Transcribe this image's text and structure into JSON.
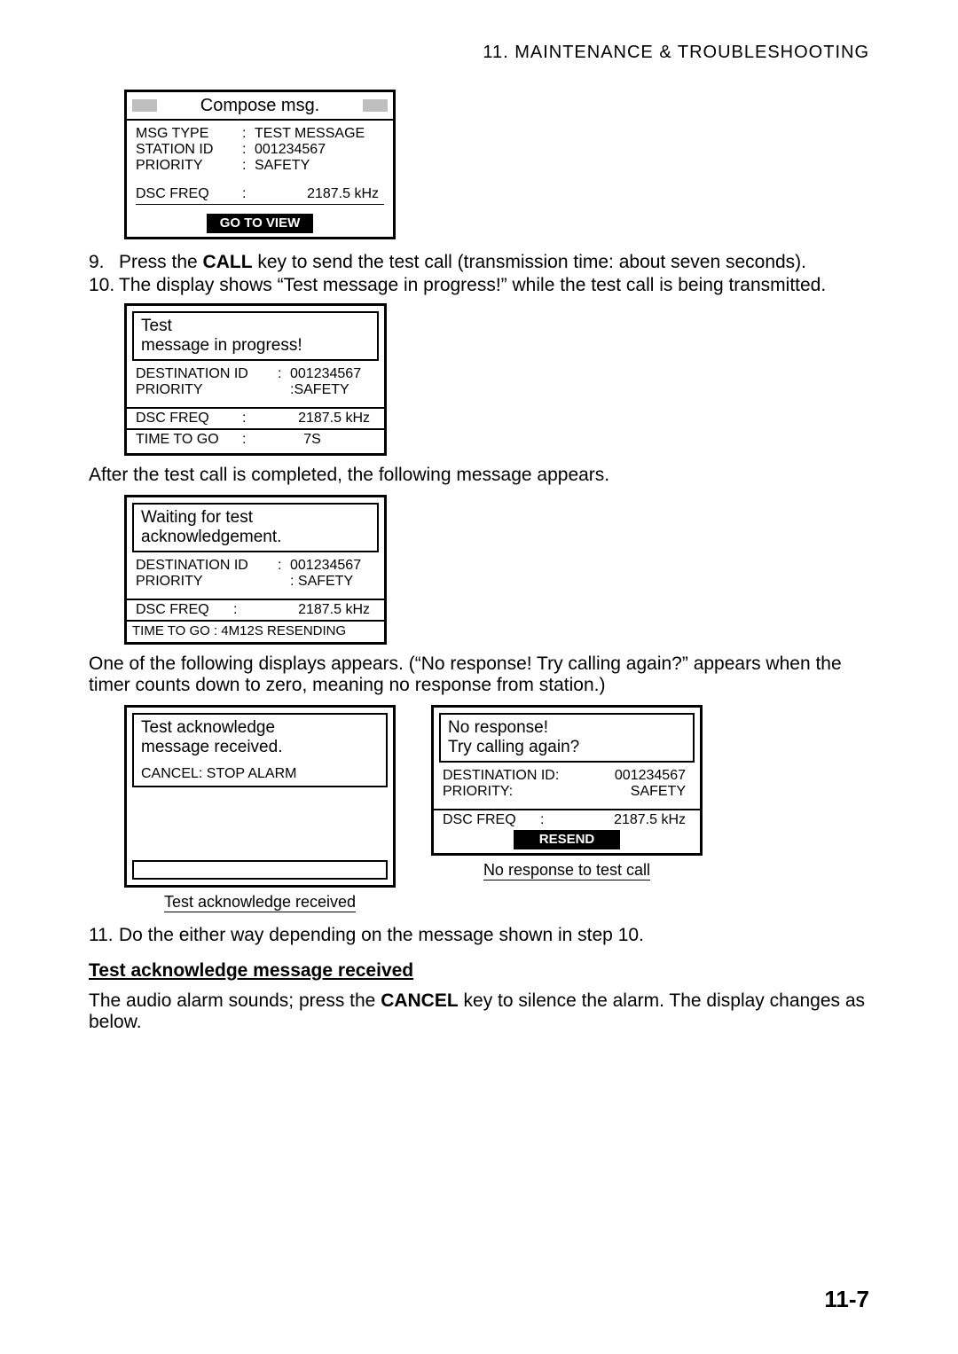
{
  "header": "11.  MAINTENANCE  &  TROUBLESHOOTING",
  "page_number": "11-7",
  "compose": {
    "title": "Compose msg.",
    "rows": [
      {
        "label": "MSG TYPE",
        "value": "TEST MESSAGE"
      },
      {
        "label": "STATION ID",
        "value": "001234567"
      },
      {
        "label": "PRIORITY",
        "value": "SAFETY"
      }
    ],
    "freq_label": "DSC FREQ",
    "freq_value": "2187.5 kHz",
    "footer": "GO TO VIEW"
  },
  "steps_a": [
    {
      "n": "9.",
      "pre": "Press the ",
      "bold": "CALL",
      "post": " key to send the test call (transmission time: about seven seconds)."
    },
    {
      "n": "10.",
      "pre": "The display shows “Test message in progress!” while the test call is being transmitted.",
      "bold": "",
      "post": ""
    }
  ],
  "progress": {
    "line1": "Test",
    "line2": "message in progress!",
    "rows": [
      {
        "label": "DESTINATION ID",
        "value": "001234567"
      },
      {
        "label": "PRIORITY",
        "value": "SAFETY"
      }
    ],
    "freq_label": "DSC FREQ",
    "freq_value": "2187.5 kHz",
    "time_label": "TIME TO GO",
    "time_value": "7S"
  },
  "para_after": "After the test call is completed, the following message appears.",
  "waiting": {
    "line1": "Waiting for test",
    "line2": "acknowledgement.",
    "rows": [
      {
        "label": "DESTINATION ID",
        "value": "001234567"
      },
      {
        "label": "PRIORITY",
        "value": "SAFETY"
      }
    ],
    "freq_label": "DSC FREQ",
    "freq_value": "2187.5 kHz",
    "time_line": "TIME TO GO :  4M12S   RESENDING"
  },
  "para_one_of": "One of the following displays appears. (“No response! Try calling again?” appears when the timer counts down to zero, meaning no response from station.)",
  "ack": {
    "line1": "Test acknowledge",
    "line2": "message received.",
    "cancel": "CANCEL: STOP ALARM",
    "caption": "Test acknowledge received"
  },
  "noresp": {
    "line1": "No response!",
    "line2": "Try calling again?",
    "rows": [
      {
        "label": "DESTINATION ID:",
        "value": "001234567"
      },
      {
        "label": "PRIORITY:",
        "value": "SAFETY"
      }
    ],
    "freq_label": "DSC FREQ",
    "freq_value": "2187.5 kHz",
    "footer": "RESEND",
    "caption": "No response to test call"
  },
  "steps_b": [
    {
      "n": "11.",
      "text": "Do the either way depending on the message shown in step 10."
    }
  ],
  "subheading": "Test acknowledge message received",
  "para_audio_pre": "The audio alarm sounds; press the ",
  "para_audio_bold": "CANCEL",
  "para_audio_post": " key to silence the alarm. The display changes as below."
}
